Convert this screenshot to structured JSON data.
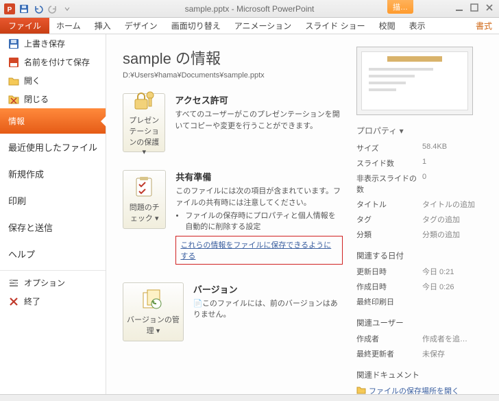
{
  "window": {
    "title": "sample.pptx - Microsoft PowerPoint",
    "tool_tab": "描…"
  },
  "ribbon": {
    "file": "ファイル",
    "tabs": [
      "ホーム",
      "挿入",
      "デザイン",
      "画面切り替え",
      "アニメーション",
      "スライド ショー",
      "校閲",
      "表示"
    ],
    "format": "書式"
  },
  "sidebar": {
    "save": "上書き保存",
    "saveas": "名前を付けて保存",
    "open": "開く",
    "close": "閉じる",
    "info": "情報",
    "recent": "最近使用したファイル",
    "new": "新規作成",
    "print": "印刷",
    "share": "保存と送信",
    "help": "ヘルプ",
    "options": "オプション",
    "exit": "終了"
  },
  "main": {
    "title": "sample の情報",
    "path": "D:¥Users¥hama¥Documents¥sample.pptx",
    "protect": {
      "btn": "プレゼンテーションの保護 ▾",
      "hdr": "アクセス許可",
      "body": "すべてのユーザーがこのプレゼンテーションを開いてコピーや変更を行うことができます。"
    },
    "check": {
      "btn": "問題のチェック ▾",
      "hdr": "共有準備",
      "body": "このファイルには次の項目が含まれています。ファイルの共有時には注意してください。",
      "li1": "ファイルの保存時にプロパティと個人情報を自動的に削除する設定",
      "link": "これらの情報をファイルに保存できるようにする"
    },
    "versions": {
      "btn": "バージョンの管理 ▾",
      "hdr": "バージョン",
      "body": "このファイルには、前のバージョンはありません。"
    }
  },
  "props": {
    "hdr": "プロパティ ▾",
    "size_k": "サイズ",
    "size_v": "58.4KB",
    "slides_k": "スライド数",
    "slides_v": "1",
    "hidden_k": "非表示スライドの数",
    "hidden_v": "0",
    "title_k": "タイトル",
    "title_v": "タイトルの追加",
    "tag_k": "タグ",
    "tag_v": "タグの追加",
    "cat_k": "分類",
    "cat_v": "分類の追加",
    "dates_hdr": "関連する日付",
    "upd_k": "更新日時",
    "upd_v": "今日 0:21",
    "crt_k": "作成日時",
    "crt_v": "今日 0:26",
    "prt_k": "最終印刷日",
    "prt_v": "",
    "users_hdr": "関連ユーザー",
    "author_k": "作成者",
    "author_v": "作成者を追…",
    "lastmod_k": "最終更新者",
    "lastmod_v": "未保存",
    "docs_hdr": "関連ドキュメント",
    "openloc": "ファイルの保存場所を開く"
  }
}
